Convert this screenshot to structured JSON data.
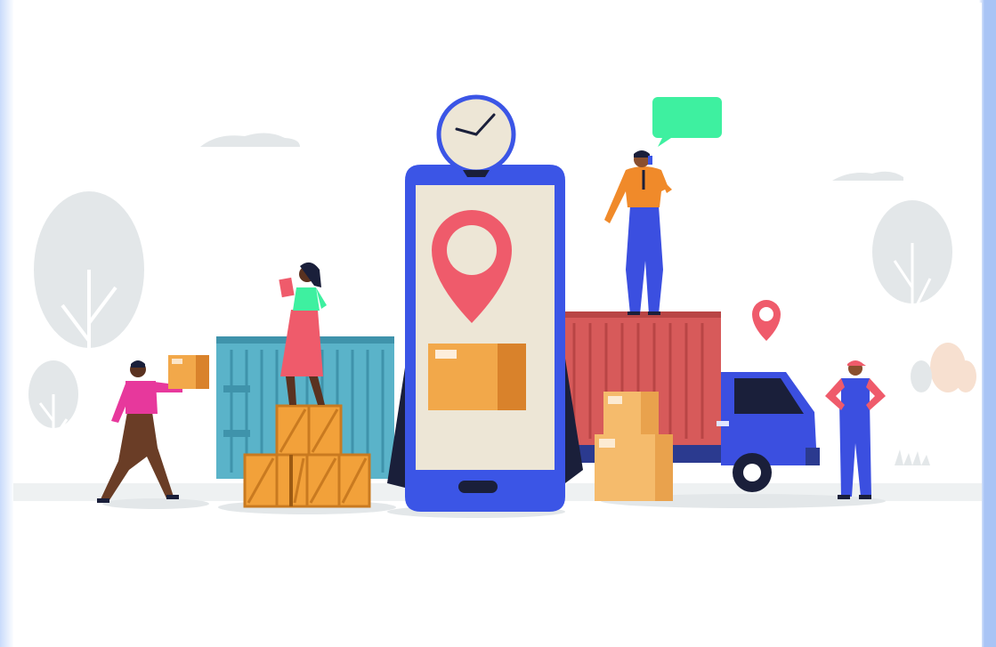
{
  "illustration": {
    "theme": "delivery-logistics",
    "elements": [
      "clock-icon",
      "smartphone",
      "map-pin-icon",
      "parcel-box",
      "chat-bubble-icon",
      "shipping-container-blue",
      "shipping-container-red",
      "delivery-truck",
      "wooden-crates",
      "cardboard-boxes",
      "person-carrying-box",
      "woman-with-clipboard",
      "man-on-phone",
      "delivery-worker"
    ]
  },
  "colors": {
    "phone_body": "#3b55e6",
    "phone_screen": "#ede6d6",
    "pin": "#ef5b6b",
    "box": "#f2a84a",
    "box_dark": "#d9822b",
    "container_blue": "#5ab3c9",
    "container_red": "#d75a5a",
    "truck": "#3b4fe0",
    "chat_bubble": "#3ef0a0",
    "crate": "#f2a13a",
    "cardboard": "#f5bb6c",
    "background_shapes": "#e3e7e9",
    "side_border": "#a9c4f5"
  }
}
